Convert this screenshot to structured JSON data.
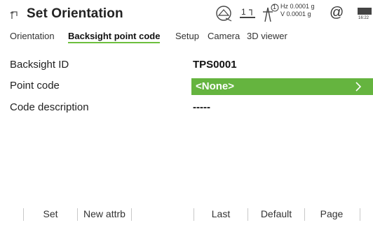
{
  "header": {
    "title": "Set Orientation",
    "status": {
      "layers_label": "1",
      "tilt_label": "1",
      "hz_line": "Hz 0.0001 g",
      "v_line": "V  0.0001 g",
      "at_symbol": "@",
      "battery_time": "16:22"
    }
  },
  "tabs": [
    {
      "label": "Orientation",
      "active": false
    },
    {
      "label": "Backsight point code",
      "active": true
    },
    {
      "label": "Setup",
      "active": false
    },
    {
      "label": "Camera",
      "active": false
    },
    {
      "label": "3D viewer",
      "active": false
    }
  ],
  "fields": {
    "backsight_id": {
      "label": "Backsight ID",
      "value": "TPS0001"
    },
    "point_code": {
      "label": "Point code",
      "value": "<None>"
    },
    "code_description": {
      "label": "Code description",
      "value": "-----"
    }
  },
  "softkeys": [
    "Set",
    "New attrb",
    "Last",
    "Default",
    "Page"
  ],
  "colors": {
    "accent": "#65b43f"
  }
}
